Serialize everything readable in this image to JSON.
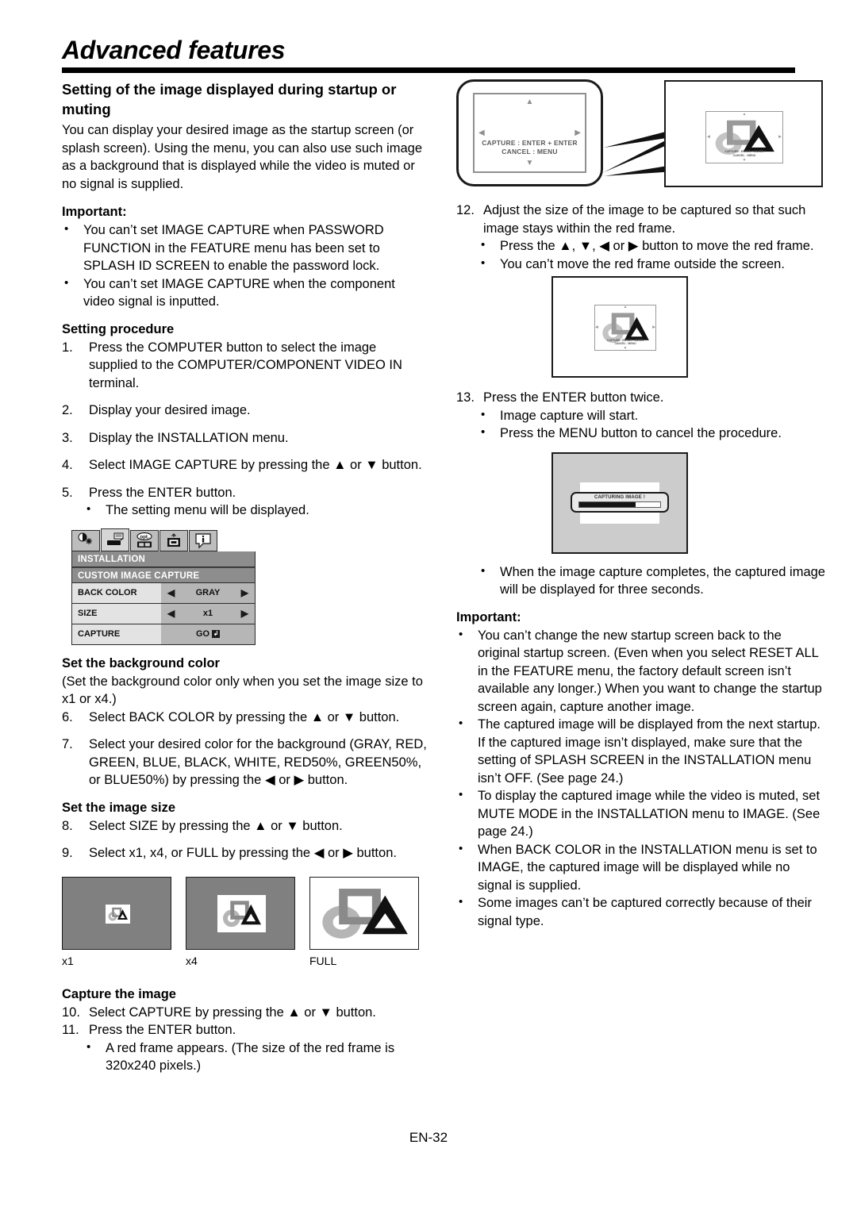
{
  "document": {
    "title": "Advanced features",
    "page_number": "EN-32"
  },
  "left_column": {
    "section_heading": "Setting of the image displayed during startup or muting",
    "intro": "You can display your desired image as the startup screen (or splash screen). Using the menu, you can also use such image as a background that is displayed while the video is muted or no signal is supplied.",
    "important_heading": "Important:",
    "important_bullets": [
      "You can’t set IMAGE CAPTURE when PASSWORD FUNCTION in the FEATURE menu has been set to SPLASH ID SCREEN to enable the password lock.",
      "You can’t set IMAGE CAPTURE when the component video signal is inputted."
    ],
    "procedure_heading": "Setting procedure",
    "steps": [
      {
        "num": "1.",
        "text": "Press the COMPUTER button to select the image supplied to the COMPUTER/COMPONENT VIDEO IN terminal."
      },
      {
        "num": "2.",
        "text": "Display your desired image."
      },
      {
        "num": "3.",
        "text": "Display the INSTALLATION menu."
      },
      {
        "num": "4.",
        "text": "Select IMAGE CAPTURE by pressing the ▲ or ▼ button."
      },
      {
        "num": "5.",
        "text": "Press the ENTER button."
      }
    ],
    "step5_bullet": "The setting menu will be displayed.",
    "osd_menu": {
      "tabs": [
        "image-adjust-icon",
        "installation-icon",
        "option-icon",
        "signal-icon",
        "information-icon"
      ],
      "active_tab_index": 1,
      "header_1": "INSTALLATION",
      "header_2": "CUSTOM IMAGE CAPTURE",
      "rows": [
        {
          "label": "BACK COLOR",
          "value": "GRAY",
          "has_arrows": true
        },
        {
          "label": "SIZE",
          "value": "x1",
          "has_arrows": true
        },
        {
          "label": "CAPTURE",
          "value": "GO",
          "has_arrows": false,
          "badge": "↲"
        }
      ]
    },
    "bg_color_heading": "Set the background color",
    "bg_color_note": "(Set the background color only when you set the image size to x1 or x4.)",
    "steps_bg": [
      {
        "num": "6.",
        "text": "Select BACK COLOR by pressing the ▲ or ▼ button."
      },
      {
        "num": "7.",
        "text": "Select your desired color for the background (GRAY, RED, GREEN, BLUE, BLACK, WHITE, RED50%, GREEN50%, or BLUE50%) by pressing the ◀ or ▶ button."
      }
    ],
    "image_size_heading": "Set the image size",
    "steps_size": [
      {
        "num": "8.",
        "text": "Select SIZE by pressing the ▲ or ▼ button."
      },
      {
        "num": "9.",
        "text": "Select x1, x4, or FULL by pressing the ◀ or ▶ button."
      }
    ],
    "size_examples": [
      {
        "caption": "x1",
        "background": "#808080"
      },
      {
        "caption": "x4",
        "background": "#808080"
      },
      {
        "caption": "FULL",
        "background": "#ffffff"
      }
    ],
    "capture_heading": "Capture the image",
    "steps_capture": [
      {
        "num": "10.",
        "text": "Select CAPTURE by pressing the ▲ or ▼ button."
      },
      {
        "num": "11.",
        "text": "Press the ENTER button."
      }
    ],
    "step11_bullet": "A red frame appears. (The size of the red frame is 320x240 pixels.)"
  },
  "right_column": {
    "figure_top": {
      "osd_line_1": "CAPTURE : ENTER + ENTER",
      "osd_line_2": "CANCEL : MENU"
    },
    "step12": {
      "num": "12.",
      "text": "Adjust the size of the image to be captured so that such image stays within the red frame."
    },
    "step12_bullets": [
      "Press the ▲, ▼, ◀ or ▶ button to move the red frame.",
      "You can’t move the red frame outside the screen."
    ],
    "step13": {
      "num": "13.",
      "text": "Press the ENTER button twice."
    },
    "step13_bullets": [
      "Image capture will start.",
      "Press the MENU button to cancel the procedure."
    ],
    "capture_dialog": {
      "title": "CAPTURING IMAGE !",
      "progress_percent": 70
    },
    "after_capture_bullet": "When the image capture completes, the captured image will be displayed for three seconds.",
    "important_heading": "Important:",
    "important_bullets": [
      "You can’t change the new startup screen back to the original startup screen. (Even when you select RESET ALL in the FEATURE menu, the factory default screen isn’t available any longer.) When you want to change the startup screen again, capture another image.",
      "The captured image will be displayed from the next startup. If the captured image isn’t displayed, make sure that the setting of SPLASH SCREEN in the INSTALLATION menu isn’t OFF. (See page 24.)",
      "To display the captured image while the video is muted, set MUTE MODE in the INSTALLATION menu to IMAGE. (See page 24.)",
      "When BACK COLOR in the INSTALLATION menu is set to IMAGE, the captured image will be displayed while no signal is supplied.",
      "Some images can’t be captured correctly because of their signal type."
    ]
  },
  "colors": {
    "ink": "#000000",
    "osd_header_bg": "#8d8d8d",
    "osd_label_bg": "#e3e3e3",
    "osd_value_bg": "#b6b6b6",
    "screen_gray": "#808080",
    "dialog_gray": "#cccccc"
  }
}
